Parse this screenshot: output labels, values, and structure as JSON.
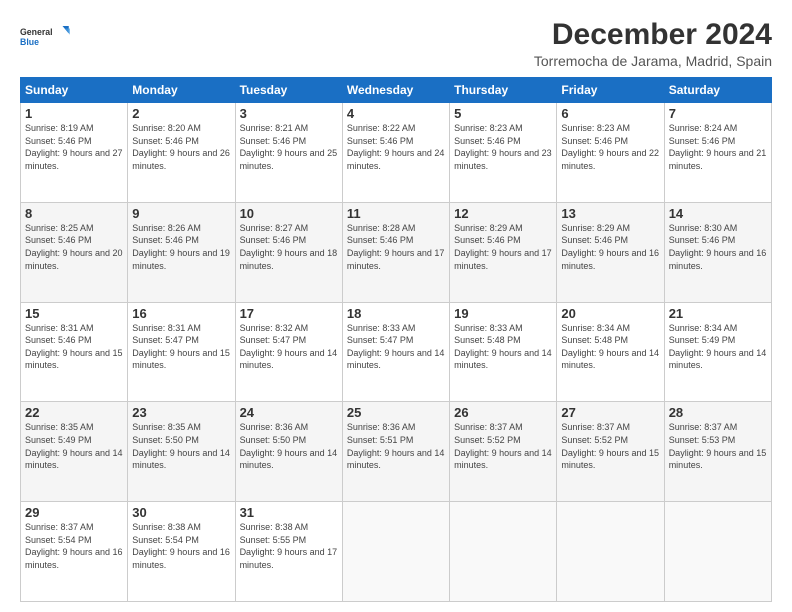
{
  "logo": {
    "line1": "General",
    "line2": "Blue"
  },
  "header": {
    "title": "December 2024",
    "subtitle": "Torremocha de Jarama, Madrid, Spain"
  },
  "weekdays": [
    "Sunday",
    "Monday",
    "Tuesday",
    "Wednesday",
    "Thursday",
    "Friday",
    "Saturday"
  ],
  "weeks": [
    [
      {
        "day": "1",
        "sunrise": "8:19 AM",
        "sunset": "5:46 PM",
        "daylight": "9 hours and 27 minutes."
      },
      {
        "day": "2",
        "sunrise": "8:20 AM",
        "sunset": "5:46 PM",
        "daylight": "9 hours and 26 minutes."
      },
      {
        "day": "3",
        "sunrise": "8:21 AM",
        "sunset": "5:46 PM",
        "daylight": "9 hours and 25 minutes."
      },
      {
        "day": "4",
        "sunrise": "8:22 AM",
        "sunset": "5:46 PM",
        "daylight": "9 hours and 24 minutes."
      },
      {
        "day": "5",
        "sunrise": "8:23 AM",
        "sunset": "5:46 PM",
        "daylight": "9 hours and 23 minutes."
      },
      {
        "day": "6",
        "sunrise": "8:23 AM",
        "sunset": "5:46 PM",
        "daylight": "9 hours and 22 minutes."
      },
      {
        "day": "7",
        "sunrise": "8:24 AM",
        "sunset": "5:46 PM",
        "daylight": "9 hours and 21 minutes."
      }
    ],
    [
      {
        "day": "8",
        "sunrise": "8:25 AM",
        "sunset": "5:46 PM",
        "daylight": "9 hours and 20 minutes."
      },
      {
        "day": "9",
        "sunrise": "8:26 AM",
        "sunset": "5:46 PM",
        "daylight": "9 hours and 19 minutes."
      },
      {
        "day": "10",
        "sunrise": "8:27 AM",
        "sunset": "5:46 PM",
        "daylight": "9 hours and 18 minutes."
      },
      {
        "day": "11",
        "sunrise": "8:28 AM",
        "sunset": "5:46 PM",
        "daylight": "9 hours and 17 minutes."
      },
      {
        "day": "12",
        "sunrise": "8:29 AM",
        "sunset": "5:46 PM",
        "daylight": "9 hours and 17 minutes."
      },
      {
        "day": "13",
        "sunrise": "8:29 AM",
        "sunset": "5:46 PM",
        "daylight": "9 hours and 16 minutes."
      },
      {
        "day": "14",
        "sunrise": "8:30 AM",
        "sunset": "5:46 PM",
        "daylight": "9 hours and 16 minutes."
      }
    ],
    [
      {
        "day": "15",
        "sunrise": "8:31 AM",
        "sunset": "5:46 PM",
        "daylight": "9 hours and 15 minutes."
      },
      {
        "day": "16",
        "sunrise": "8:31 AM",
        "sunset": "5:47 PM",
        "daylight": "9 hours and 15 minutes."
      },
      {
        "day": "17",
        "sunrise": "8:32 AM",
        "sunset": "5:47 PM",
        "daylight": "9 hours and 14 minutes."
      },
      {
        "day": "18",
        "sunrise": "8:33 AM",
        "sunset": "5:47 PM",
        "daylight": "9 hours and 14 minutes."
      },
      {
        "day": "19",
        "sunrise": "8:33 AM",
        "sunset": "5:48 PM",
        "daylight": "9 hours and 14 minutes."
      },
      {
        "day": "20",
        "sunrise": "8:34 AM",
        "sunset": "5:48 PM",
        "daylight": "9 hours and 14 minutes."
      },
      {
        "day": "21",
        "sunrise": "8:34 AM",
        "sunset": "5:49 PM",
        "daylight": "9 hours and 14 minutes."
      }
    ],
    [
      {
        "day": "22",
        "sunrise": "8:35 AM",
        "sunset": "5:49 PM",
        "daylight": "9 hours and 14 minutes."
      },
      {
        "day": "23",
        "sunrise": "8:35 AM",
        "sunset": "5:50 PM",
        "daylight": "9 hours and 14 minutes."
      },
      {
        "day": "24",
        "sunrise": "8:36 AM",
        "sunset": "5:50 PM",
        "daylight": "9 hours and 14 minutes."
      },
      {
        "day": "25",
        "sunrise": "8:36 AM",
        "sunset": "5:51 PM",
        "daylight": "9 hours and 14 minutes."
      },
      {
        "day": "26",
        "sunrise": "8:37 AM",
        "sunset": "5:52 PM",
        "daylight": "9 hours and 14 minutes."
      },
      {
        "day": "27",
        "sunrise": "8:37 AM",
        "sunset": "5:52 PM",
        "daylight": "9 hours and 15 minutes."
      },
      {
        "day": "28",
        "sunrise": "8:37 AM",
        "sunset": "5:53 PM",
        "daylight": "9 hours and 15 minutes."
      }
    ],
    [
      {
        "day": "29",
        "sunrise": "8:37 AM",
        "sunset": "5:54 PM",
        "daylight": "9 hours and 16 minutes."
      },
      {
        "day": "30",
        "sunrise": "8:38 AM",
        "sunset": "5:54 PM",
        "daylight": "9 hours and 16 minutes."
      },
      {
        "day": "31",
        "sunrise": "8:38 AM",
        "sunset": "5:55 PM",
        "daylight": "9 hours and 17 minutes."
      },
      null,
      null,
      null,
      null
    ]
  ],
  "labels": {
    "sunrise": "Sunrise:",
    "sunset": "Sunset:",
    "daylight": "Daylight:"
  }
}
